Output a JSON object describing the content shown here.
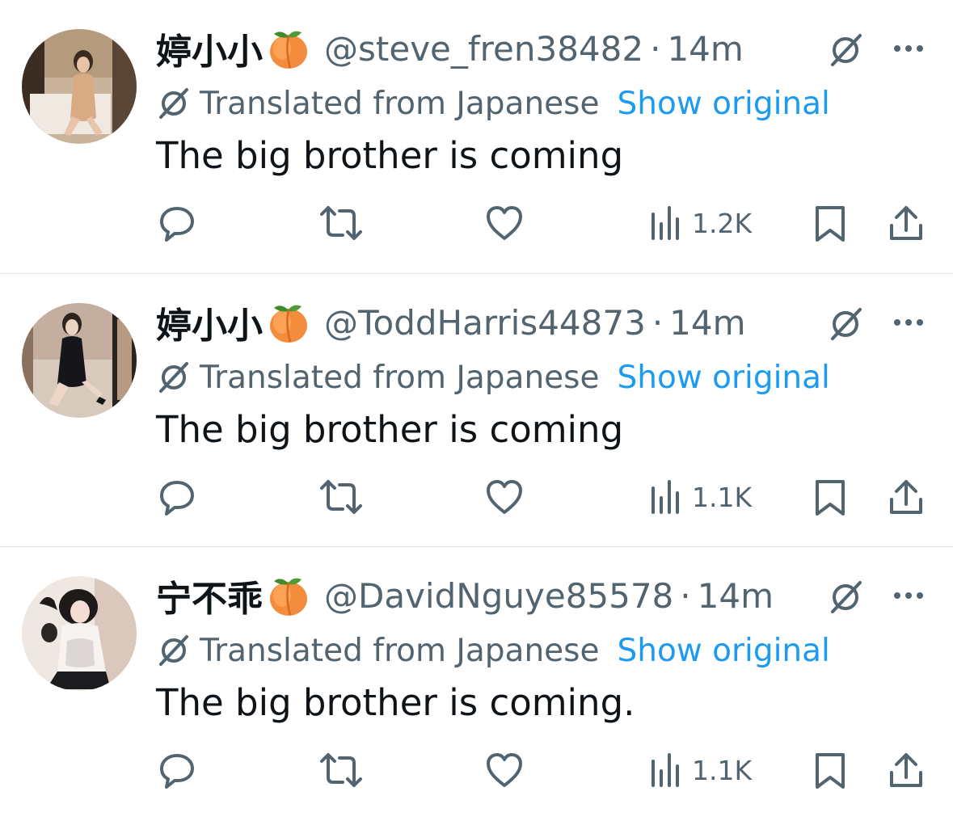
{
  "tweets": [
    {
      "display_name": "婷小小",
      "name_emoji": "peach-icon",
      "handle": "@steve_fren38482",
      "separator": "·",
      "time": "14m",
      "translated_label": "Translated from Japanese",
      "show_original_label": "Show original",
      "text": "The big brother is coming",
      "views": "1.2K"
    },
    {
      "display_name": "婷小小",
      "name_emoji": "peach-icon",
      "handle": "@ToddHarris44873",
      "separator": "·",
      "time": "14m",
      "translated_label": "Translated from Japanese",
      "show_original_label": "Show original",
      "text": "The big brother is coming",
      "views": "1.1K"
    },
    {
      "display_name": "宁不乖",
      "name_emoji": "peach-icon",
      "handle": "@DavidNguye85578",
      "separator": "·",
      "time": "14m",
      "translated_label": "Translated from Japanese",
      "show_original_label": "Show original",
      "text": "The big brother is coming.",
      "views": "1.1K"
    }
  ],
  "colors": {
    "primary_text": "#0f1419",
    "secondary_text": "#536471",
    "link": "#1d9bf0",
    "divider": "#e1e5e8"
  },
  "icons": {
    "header": [
      "grok-icon",
      "more-icon"
    ],
    "translation": "translate-icon",
    "actions": [
      "reply-icon",
      "retweet-icon",
      "like-icon",
      "views-icon",
      "bookmark-icon",
      "share-icon"
    ]
  }
}
